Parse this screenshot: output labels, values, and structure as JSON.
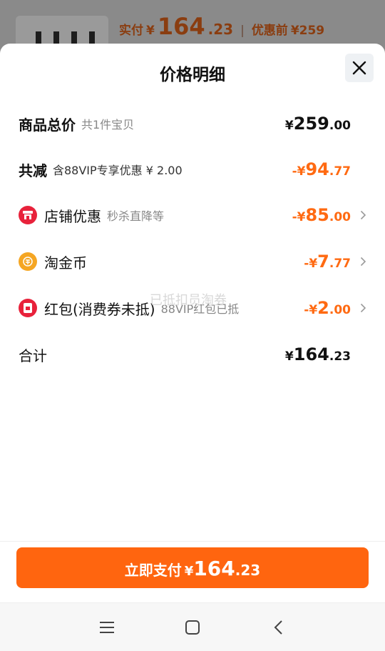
{
  "background": {
    "pay_label": "实付",
    "currency": "¥",
    "pay_int": "164",
    "pay_dec": ".23",
    "before_label": "优惠前",
    "before_value": "¥259"
  },
  "sheet": {
    "title": "价格明细",
    "rows": {
      "total": {
        "label": "商品总价",
        "sub": "共1件宝贝",
        "cur": "¥",
        "int": "259",
        "dec": ".00"
      },
      "reduce": {
        "label": "共减",
        "sub": "含88VIP专享优惠 ¥ 2.00",
        "cur": "-¥",
        "int": "94",
        "dec": ".77"
      },
      "store": {
        "label": "店铺优惠",
        "sub": "秒杀直降等",
        "cur": "-¥",
        "int": "85",
        "dec": ".00",
        "icon": "store-icon"
      },
      "coin": {
        "label": "淘金币",
        "sub": "",
        "cur": "-¥",
        "int": "7",
        "dec": ".77",
        "icon": "coin-icon"
      },
      "redpacket": {
        "label": "红包(消费券未抵)",
        "sub": "88VIP红包已抵",
        "cur": "-¥",
        "int": "2",
        "dec": ".00",
        "icon": "red-packet-icon"
      },
      "sum": {
        "label": "合计",
        "cur": "¥",
        "int": "164",
        "dec": ".23"
      }
    },
    "watermark": "已抵扣员淘券",
    "pay_button": {
      "label": "立即支付",
      "cur": "¥",
      "int": "164",
      "dec": ".23"
    }
  },
  "colors": {
    "accent": "#ff650f",
    "amount_orange": "#ff6a12",
    "store_icon": "#e8223b",
    "coin_icon": "#f5a623"
  },
  "nav": {
    "icons": [
      "menu-icon",
      "home-icon",
      "back-icon"
    ]
  }
}
